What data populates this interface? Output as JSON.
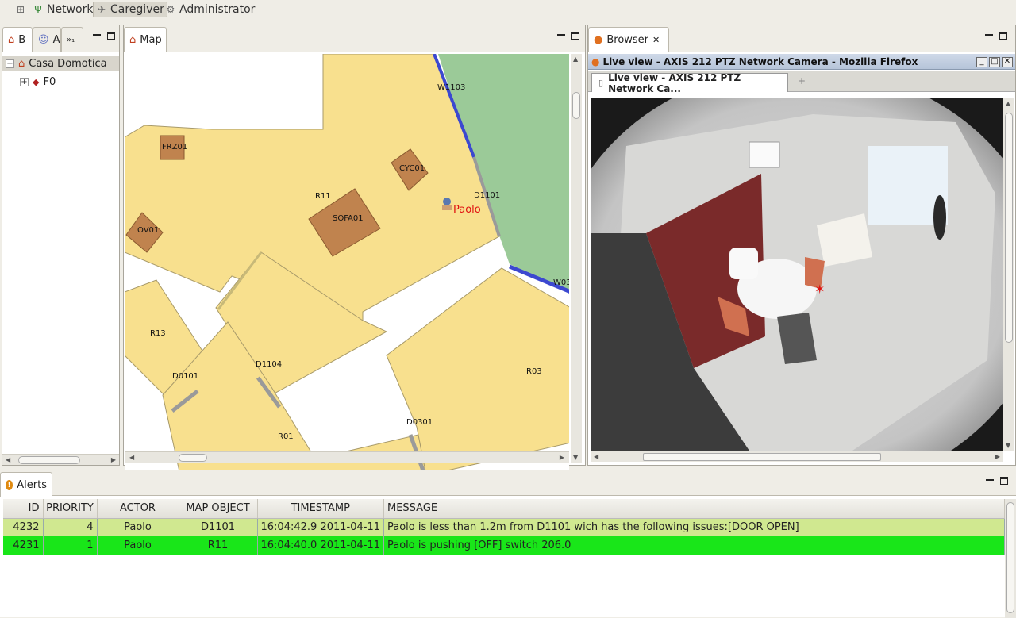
{
  "perspectives": [
    {
      "label": "",
      "icon": "open-perspective-icon",
      "active": false
    },
    {
      "label": "Network",
      "icon": "network-antenna-icon",
      "active": false
    },
    {
      "label": "Caregiver",
      "icon": "caregiver-icon",
      "active": true
    },
    {
      "label": "Administrator",
      "icon": "gear-icon",
      "active": false
    }
  ],
  "left_panel": {
    "tabs": [
      {
        "label": "B",
        "icon": "house-icon"
      },
      {
        "label": "A",
        "icon": "users-icon"
      },
      {
        "label": "»₁",
        "icon": "overflow-icon"
      }
    ],
    "tree": [
      {
        "label": "Casa Domotica",
        "expander": "−",
        "icon": "house-icon",
        "level": 0
      },
      {
        "label": "F0",
        "expander": "+",
        "icon": "floor-icon",
        "level": 1
      }
    ]
  },
  "map_panel": {
    "tab_label": "Map",
    "labels": {
      "w1103": "W1103",
      "frz01": "FRZ01",
      "cyc01": "CYC01",
      "d1101": "D1101",
      "r11": "R11",
      "sofa01": "SOFA01",
      "paolo": "Paolo",
      "ov01": "OV01",
      "w03": "W03",
      "r13": "R13",
      "d0101": "D0101",
      "d1104": "D1104",
      "r03": "R03",
      "d0301": "D0301",
      "r01": "R01"
    },
    "colors": {
      "room": "#f8e08e",
      "furniture": "#c0834e",
      "garden": "#9bca98",
      "wall_blue": "#3c48d0",
      "person_label": "#e01010"
    }
  },
  "browser_panel": {
    "tab_label": "Browser",
    "window_title": "Live view - AXIS 212 PTZ Network Camera - Mozilla Firefox",
    "page_tab_label": "Live view - AXIS 212 PTZ Network Ca...",
    "new_tab_symbol": "+"
  },
  "alerts": {
    "tab_label": "Alerts",
    "columns": [
      "ID",
      "PRIORITY",
      "ACTOR",
      "MAP OBJECT",
      "TIMESTAMP",
      "MESSAGE"
    ],
    "rows": [
      {
        "id": "4232",
        "priority": "4",
        "actor": "Paolo",
        "map_object": "D1101",
        "timestamp": "2011-04-11 16:04:42.9",
        "message": "Paolo is less than 1.2m from D1101 wich has the following issues:[DOOR OPEN]",
        "color": "#d0e890"
      },
      {
        "id": "4231",
        "priority": "1",
        "actor": "Paolo",
        "map_object": "R11",
        "timestamp": "2011-04-11 16:04:40.0",
        "message": "Paolo is pushing [OFF] switch 206.0",
        "color": "#19e619"
      }
    ]
  }
}
